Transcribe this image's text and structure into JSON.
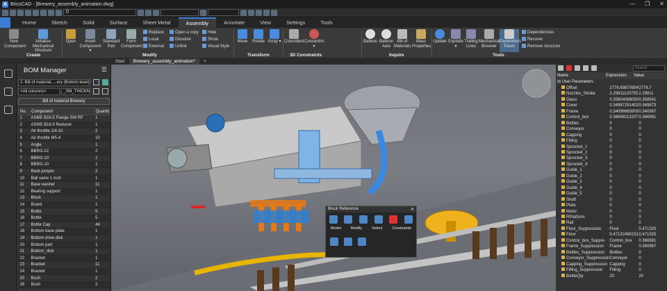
{
  "window": {
    "title": "BricsCAD - [Brewery_assembly_animation.dwg]",
    "controls": [
      "—",
      "❐",
      "✕"
    ]
  },
  "qat": {
    "layer_value": "0"
  },
  "tabs": [
    "Home",
    "Sketch",
    "Solid",
    "Surface",
    "Sheet Metal",
    "Assembly",
    "Annotate",
    "View",
    "Settings",
    "Tools"
  ],
  "active_tab": "Assembly",
  "ribbon": {
    "create": {
      "label": "Create",
      "buttons": [
        "New\nComponent",
        "Initialize Mechanical\nStructure"
      ]
    },
    "modify": {
      "label": "Modify",
      "buttons": [
        "Open",
        "Insert\nComponent ▾",
        "Standard\nPart",
        "Form\nComponent"
      ],
      "small": [
        "Replace",
        "Local",
        "External",
        "Open a copy",
        "Dissolve",
        "Unlink",
        "Hide",
        "Show",
        "Visual Style"
      ]
    },
    "transform": {
      "label": "Transform",
      "buttons": [
        "Move",
        "Rotate",
        "Array ▾"
      ]
    },
    "constraints": {
      "label": "3D Constraints",
      "buttons": [
        "Coincident",
        "Concentric ▾"
      ]
    },
    "inquire": {
      "label": "Inquire",
      "buttons": [
        "Balloon",
        "Balloon\nAuto",
        "Bill of\nMaterials",
        "Mass\nProperties"
      ]
    },
    "tools": {
      "label": "Tools",
      "buttons": [
        "Update",
        "Explode ▾",
        "Trailing\nLines",
        "Mechanical\nBrowser",
        "Parameters\nPanel"
      ],
      "small": [
        "Dependencies",
        "Recover",
        "Remove structure"
      ]
    }
  },
  "doc_tabs": [
    "Start",
    "Brewery_assembly_animation*",
    "+"
  ],
  "bom": {
    "title": "BOM Manager",
    "bom_select": "2. Bill of material.....ery (Bottom level)",
    "columns_select": "<All columns>",
    "field_select": "_SM_THICKNE",
    "bom_name": "Bill of material Brewery",
    "headers": [
      "No.",
      "Component",
      "Quantit"
    ],
    "rows": [
      [
        "1",
        "ASME B16.5 Flange SW RF",
        "1"
      ],
      [
        "2",
        "ASME B16.9 Reducer",
        "1"
      ],
      [
        "3",
        "Air throttle 1/4-10",
        "2"
      ],
      [
        "4",
        "Air throttle M5-4",
        "10"
      ],
      [
        "5",
        "Angle",
        "1"
      ],
      [
        "6",
        "BBRG-22",
        "2"
      ],
      [
        "7",
        "BBRG-10",
        "1"
      ],
      [
        "8",
        "BBRG-10",
        "1"
      ],
      [
        "9",
        "Back jumper",
        "2"
      ],
      [
        "10",
        "Ball valve 1 inch",
        "1"
      ],
      [
        "11",
        "Base washer",
        "11"
      ],
      [
        "12",
        "Bearing support",
        "1"
      ],
      [
        "13",
        "Block",
        "1"
      ],
      [
        "14",
        "Board",
        "1"
      ],
      [
        "15",
        "Bottle",
        "5"
      ],
      [
        "16",
        "Bottle",
        "5"
      ],
      [
        "17",
        "Bottle Cap",
        "44"
      ],
      [
        "18",
        "Bottom base plate",
        "1"
      ],
      [
        "19",
        "Bottom drive disk",
        "1"
      ],
      [
        "20",
        "Bottom part",
        "1"
      ],
      [
        "21",
        "Bottom_disk",
        "1"
      ],
      [
        "22",
        "Bracket",
        "1"
      ],
      [
        "23",
        "Bracket",
        "11"
      ],
      [
        "24",
        "Bracket",
        "1"
      ],
      [
        "25",
        "Bush",
        "2"
      ],
      [
        "26",
        "Bush",
        "2"
      ]
    ]
  },
  "block_reference": {
    "title": "Block Reference",
    "close": "✕",
    "labels": [
      "Model",
      "Modify",
      "Select",
      "Constraints"
    ]
  },
  "params": {
    "search_placeholder": "Search",
    "headers": [
      "Name",
      "Expression",
      "Value"
    ],
    "group": "User Parameters",
    "rows": [
      [
        "Offset",
        "2776.69870904",
        "2776.7"
      ],
      [
        "Nozzles_Stroke",
        "2.29811120755",
        "2.29811"
      ],
      [
        "Glass",
        "0.35854088050",
        "0.358541"
      ],
      [
        "Cover",
        "0.34987251402",
        "0.349873"
      ],
      [
        "Frame",
        "0.34096665805",
        "0.340967"
      ],
      [
        "Control_box",
        "0.36698113207",
        "0.366981"
      ],
      [
        "Bottles",
        "0",
        "0"
      ],
      [
        "Conveyor",
        "0",
        "0"
      ],
      [
        "Capping",
        "0",
        "0"
      ],
      [
        "Filling",
        "0",
        "0"
      ],
      [
        "Sprocket_1",
        "0",
        "0"
      ],
      [
        "Sprocket_2",
        "0",
        "0"
      ],
      [
        "Sprocket_3",
        "0",
        "0"
      ],
      [
        "Sprocket_4",
        "0",
        "0"
      ],
      [
        "Guide_1",
        "0",
        "0"
      ],
      [
        "Guide_2",
        "0",
        "0"
      ],
      [
        "Guide_3",
        "0",
        "0"
      ],
      [
        "Guide_4",
        "0",
        "0"
      ],
      [
        "Guide_5",
        "0",
        "0"
      ],
      [
        "Shaft",
        "0",
        "0"
      ],
      [
        "Plate",
        "0",
        "0"
      ],
      [
        "Motor",
        "0",
        "0"
      ],
      [
        "RPlatform",
        "0",
        "0"
      ],
      [
        "Rail",
        "0",
        "0"
      ],
      [
        "Floor_Suppression",
        "Floor",
        "0.471325"
      ],
      [
        "Floor",
        "0.47132490151",
        "0.471325"
      ],
      [
        "Control_box_Suppre",
        "Control_box",
        "0.366981"
      ],
      [
        "Frame_Suppression",
        "Frame",
        "0.340967"
      ],
      [
        "Bottles_Suppression",
        "Bottles",
        "0"
      ],
      [
        "Conveyor_Suppression",
        "Conveyor",
        "0"
      ],
      [
        "Capping_Suppression",
        "Capping",
        "0"
      ],
      [
        "Filling_Suppression",
        "Filling",
        "0"
      ],
      [
        "BottleQty",
        "20",
        "20"
      ]
    ]
  },
  "colors": {
    "accent": "#3b7dd8",
    "panel": "#333333",
    "viewport": "#74777d"
  }
}
